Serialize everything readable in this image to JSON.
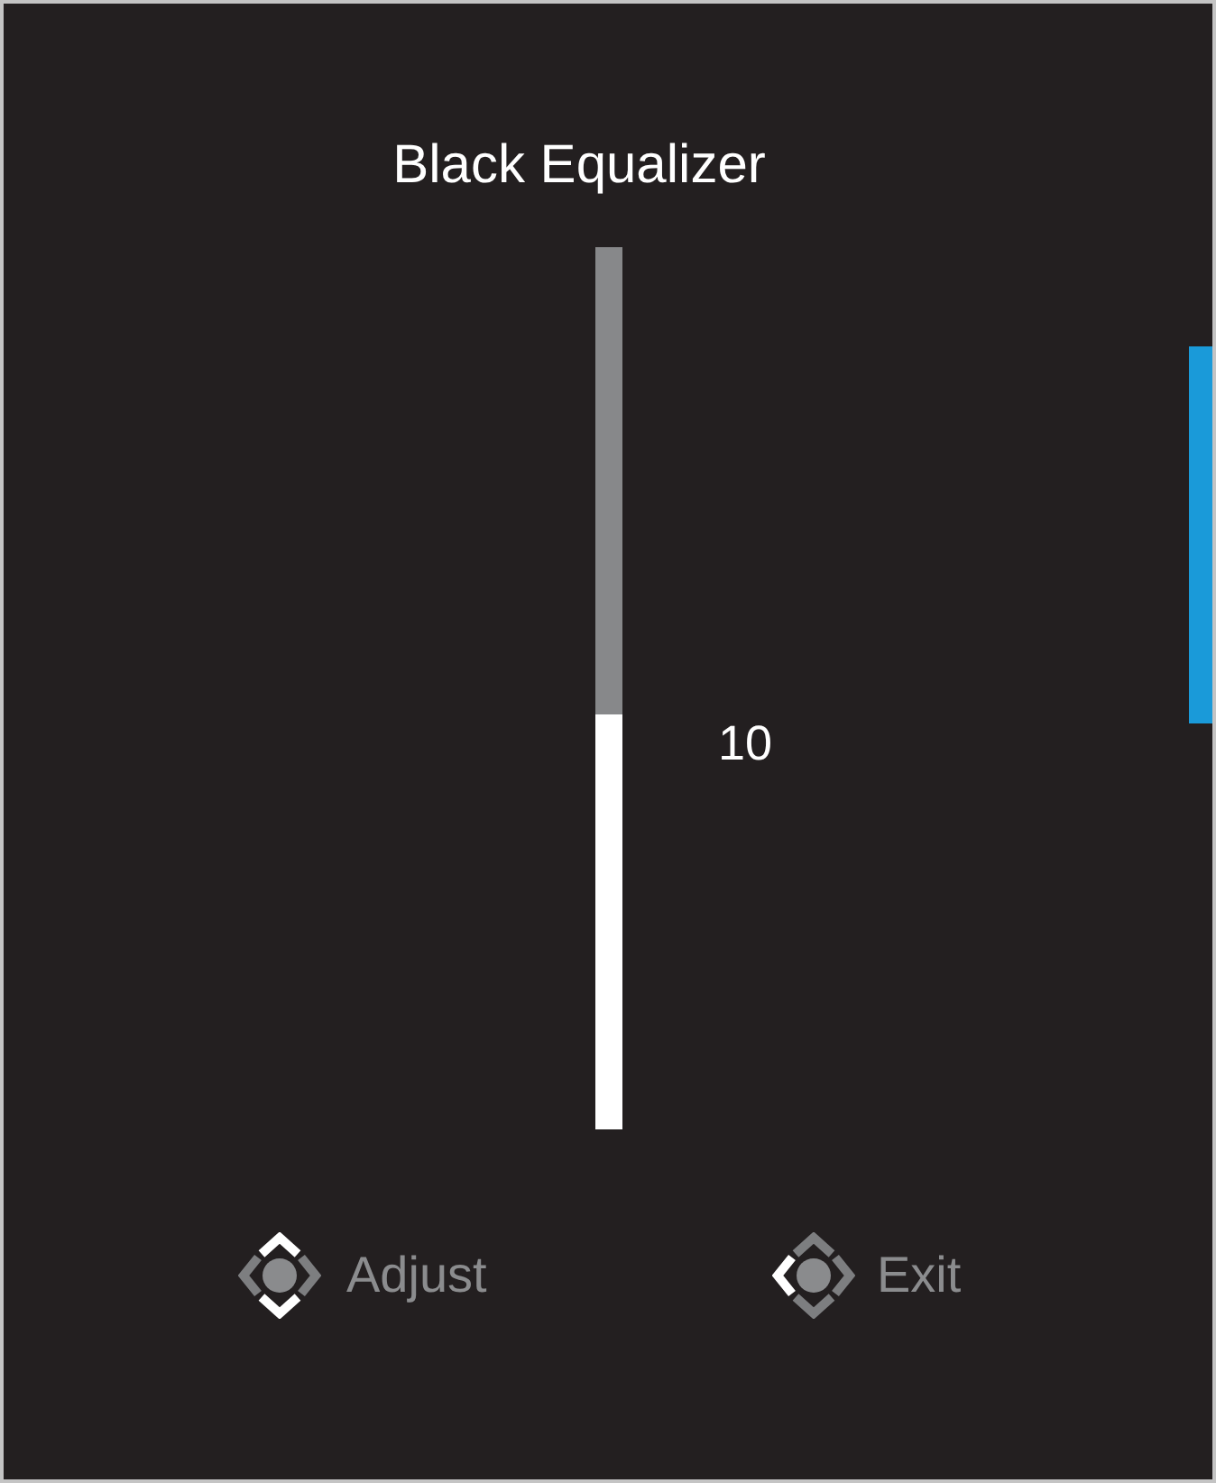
{
  "title": "Black Equalizer",
  "slider": {
    "level": 0.47,
    "reading": "10"
  },
  "legend": [
    {
      "label": "Adjust",
      "lit": {
        "up": true,
        "down": true,
        "left": false,
        "right": false
      }
    },
    {
      "label": "Exit",
      "lit": {
        "up": false,
        "down": false,
        "left": true,
        "right": false
      }
    }
  ]
}
